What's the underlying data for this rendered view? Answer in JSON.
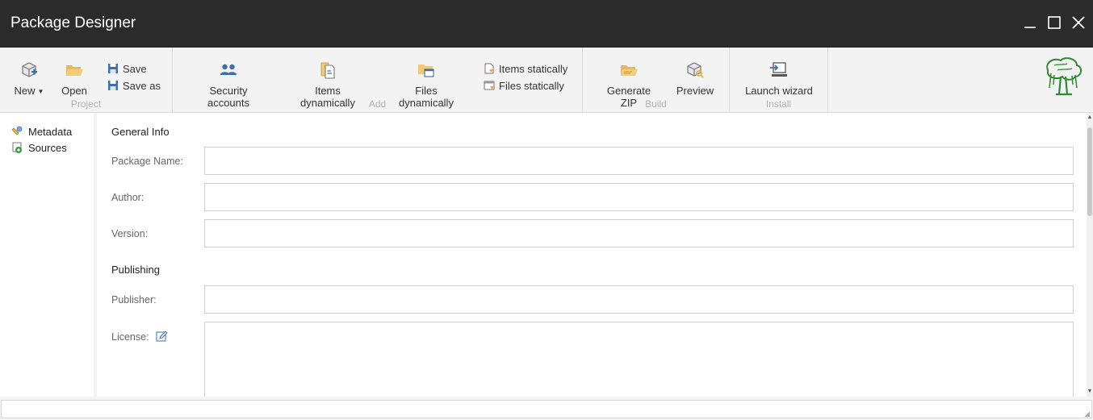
{
  "window": {
    "title": "Package Designer"
  },
  "ribbon": {
    "groups": [
      {
        "label": "Project"
      },
      {
        "label": "Add"
      },
      {
        "label": "Build"
      },
      {
        "label": "Install"
      }
    ],
    "project": {
      "new_label": "New",
      "open_label": "Open",
      "save_label": "Save",
      "save_as_label": "Save as"
    },
    "add": {
      "security_accounts_label": "Security accounts",
      "items_dynamically_label": "Items dynamically",
      "files_dynamically_label": "Files dynamically",
      "items_statically_label": "Items statically",
      "files_statically_label": "Files statically"
    },
    "build": {
      "generate_zip_label": "Generate ZIP",
      "preview_label": "Preview"
    },
    "install": {
      "launch_wizard_label": "Launch wizard"
    }
  },
  "nav": {
    "items": [
      {
        "label": "Metadata",
        "icon": "metadata-icon"
      },
      {
        "label": "Sources",
        "icon": "sources-icon"
      }
    ]
  },
  "form": {
    "general_info_title": "General Info",
    "publishing_title": "Publishing",
    "fields": {
      "package_name": {
        "label": "Package Name:",
        "value": ""
      },
      "author": {
        "label": "Author:",
        "value": ""
      },
      "version": {
        "label": "Version:",
        "value": ""
      },
      "publisher": {
        "label": "Publisher:",
        "value": ""
      },
      "license": {
        "label": "License:",
        "value": ""
      }
    }
  },
  "colors": {
    "titlebar_bg": "#2b2b2b",
    "ribbon_bg": "#f3f3f3",
    "icon_blue": "#3d6fa8",
    "icon_orange": "#f0a830",
    "logo_green": "#2e8b2e"
  }
}
